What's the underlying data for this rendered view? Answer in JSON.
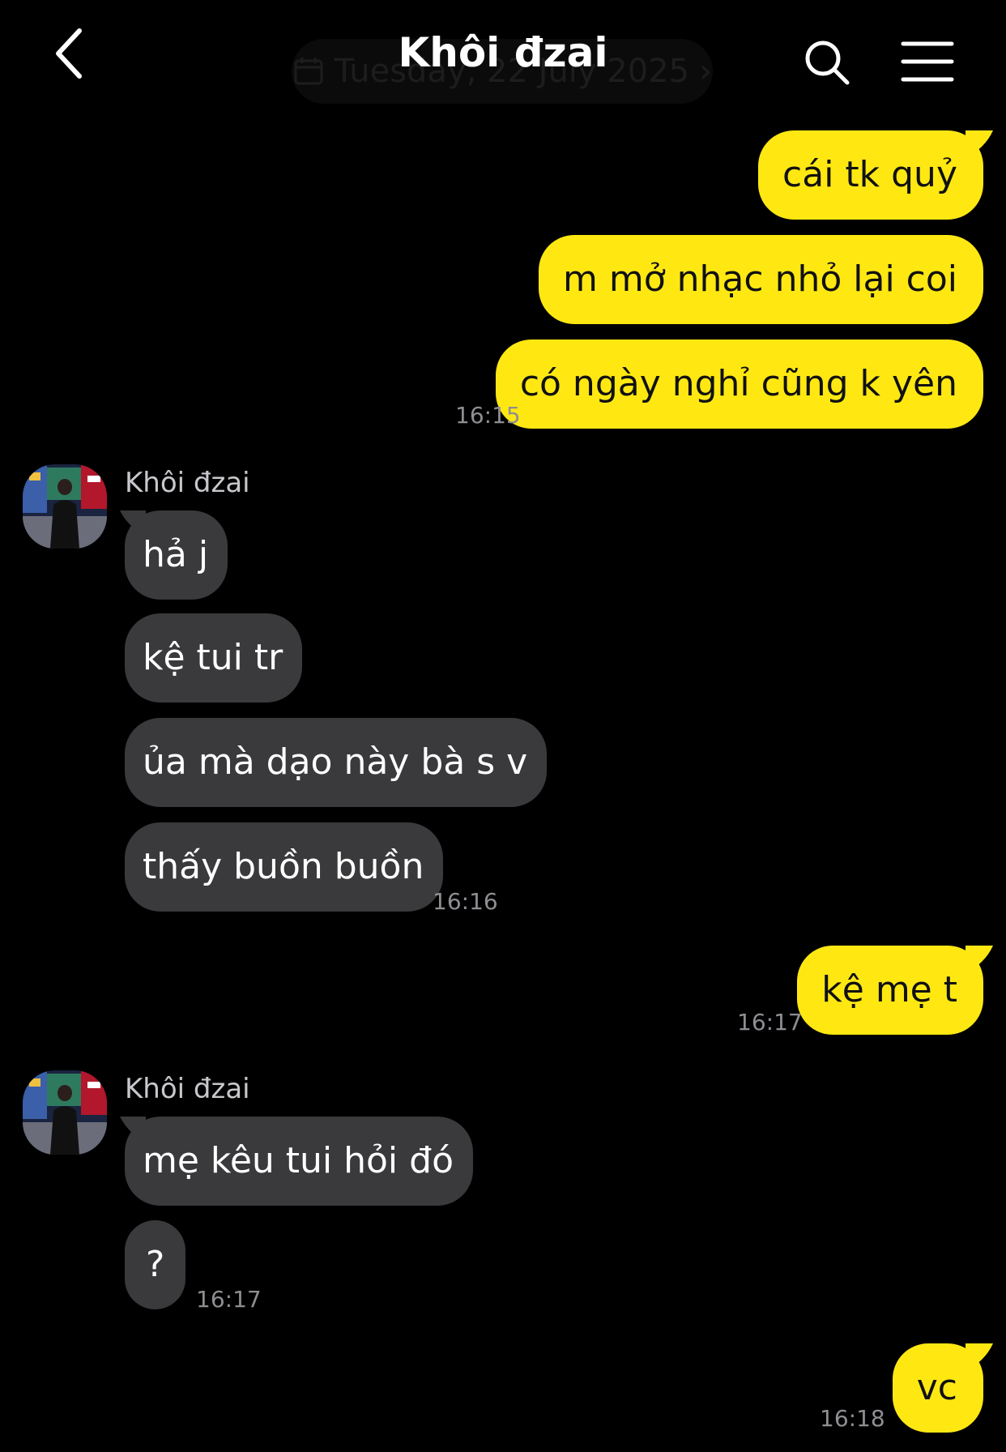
{
  "header": {
    "title": "Khôi đzai",
    "date_label": "Tuesday, 22 July 2025"
  },
  "messages": [
    {
      "text": "cái tk quỷ"
    },
    {
      "text": "m mở nhạc nhỏ lại coi"
    },
    {
      "text": "có ngày nghỉ cũng k yên",
      "time": "16:15"
    },
    {
      "sender": "Khôi đzai",
      "text": "hả j"
    },
    {
      "text": "kệ tui tr"
    },
    {
      "text": "ủa mà dạo này bà s v"
    },
    {
      "text": "thấy buồn buồn",
      "time": "16:16"
    },
    {
      "text": "kệ mẹ t",
      "time": "16:17"
    },
    {
      "sender": "Khôi đzai",
      "text": "mẹ kêu tui hỏi đó"
    },
    {
      "text": "?",
      "time": "16:17"
    },
    {
      "text": "vc",
      "time": "16:18"
    }
  ],
  "colors": {
    "outgoing_bubble": "#ffe812",
    "incoming_bubble": "#3a3a3c",
    "background": "#000000",
    "timestamp": "#8e8e93"
  },
  "icons": [
    "back-chevron-icon",
    "calendar-icon",
    "search-icon",
    "menu-icon"
  ]
}
